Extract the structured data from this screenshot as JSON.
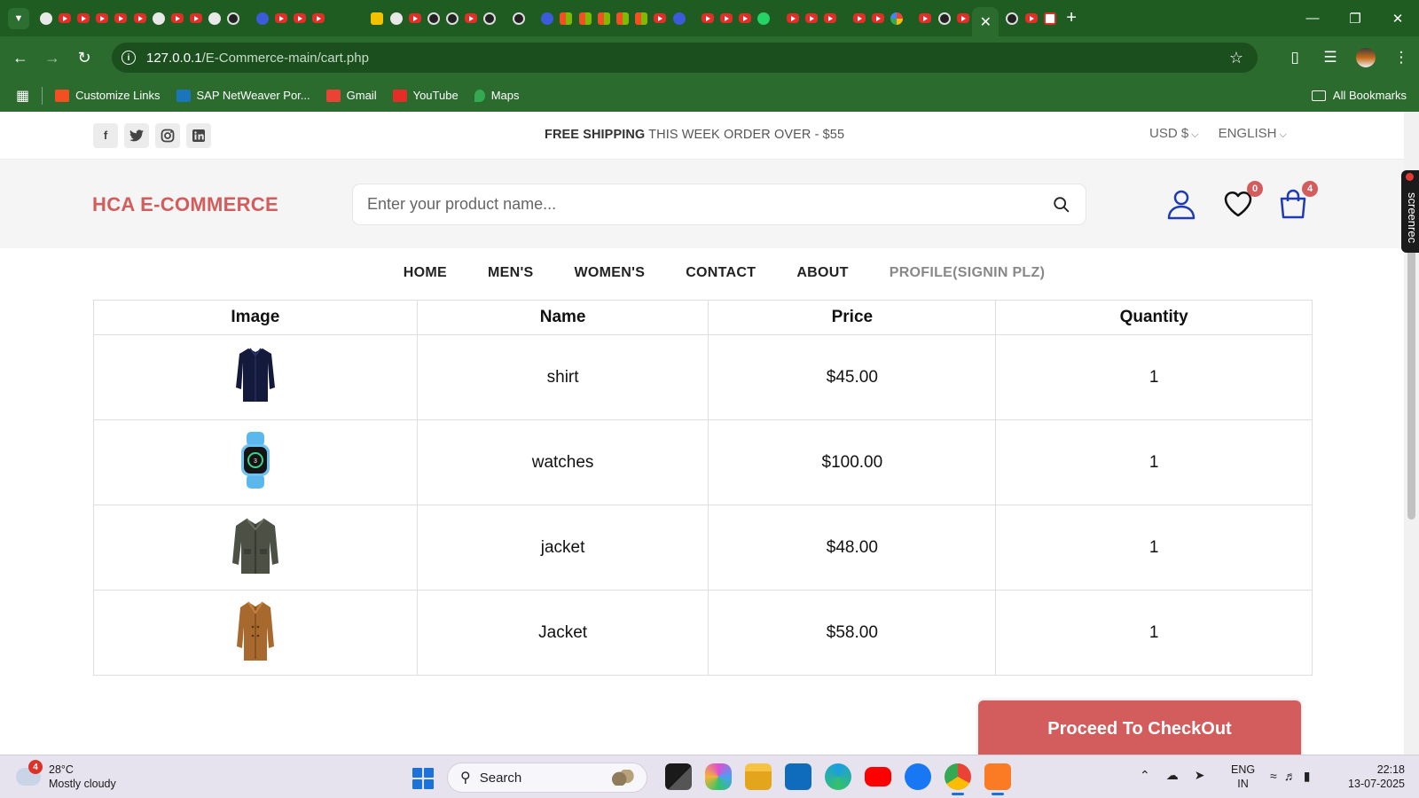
{
  "browser": {
    "url_host": "127.0.0.1",
    "url_path": "/E-Commerce-main/cart.php",
    "bookmarks": [
      {
        "label": "Customize Links",
        "color": "#f25022"
      },
      {
        "label": "SAP NetWeaver Por...",
        "color": "#1a75bb"
      },
      {
        "label": "Gmail",
        "color": "#ea4335"
      },
      {
        "label": "YouTube",
        "color": "#e52d27"
      },
      {
        "label": "Maps",
        "color": "#34a853"
      }
    ],
    "all_bookmarks": "All Bookmarks"
  },
  "topbar": {
    "socials": [
      "facebook-icon",
      "twitter-icon",
      "instagram-icon",
      "linkedin-icon"
    ],
    "promo_bold": "FREE SHIPPING",
    "promo_rest": "THIS WEEK ORDER OVER - $55",
    "currency": "USD $",
    "language": "ENGLISH"
  },
  "header": {
    "logo": "HCA E-COMMERCE",
    "search_placeholder": "Enter your product name...",
    "wishlist_count": "0",
    "cart_count": "4",
    "accent": "#d35c5c"
  },
  "menu": {
    "home": "HOME",
    "mens": "MEN'S",
    "womens": "WOMEN'S",
    "contact": "CONTACT",
    "about": "ABOUT",
    "profile": "PROFILE(SIGNIN PLZ)"
  },
  "cart": {
    "headers": {
      "image": "Image",
      "name": "Name",
      "price": "Price",
      "quantity": "Quantity"
    },
    "rows": [
      {
        "name": "shirt",
        "price": "$45.00",
        "qty": "1",
        "image": "shirt-image"
      },
      {
        "name": "watches",
        "price": "$100.00",
        "qty": "1",
        "image": "watch-image"
      },
      {
        "name": "jacket",
        "price": "$48.00",
        "qty": "1",
        "image": "jacket-image"
      },
      {
        "name": "Jacket",
        "price": "$58.00",
        "qty": "1",
        "image": "coat-image"
      }
    ],
    "checkout_label": "Proceed To CheckOut"
  },
  "screenrec_label": "screenrec",
  "taskbar": {
    "weather_temp": "28°C",
    "weather_desc": "Mostly cloudy",
    "weather_badge": "4",
    "search_label": "Search",
    "lang_line1": "ENG",
    "lang_line2": "IN",
    "time": "22:18",
    "date": "13-07-2025"
  }
}
